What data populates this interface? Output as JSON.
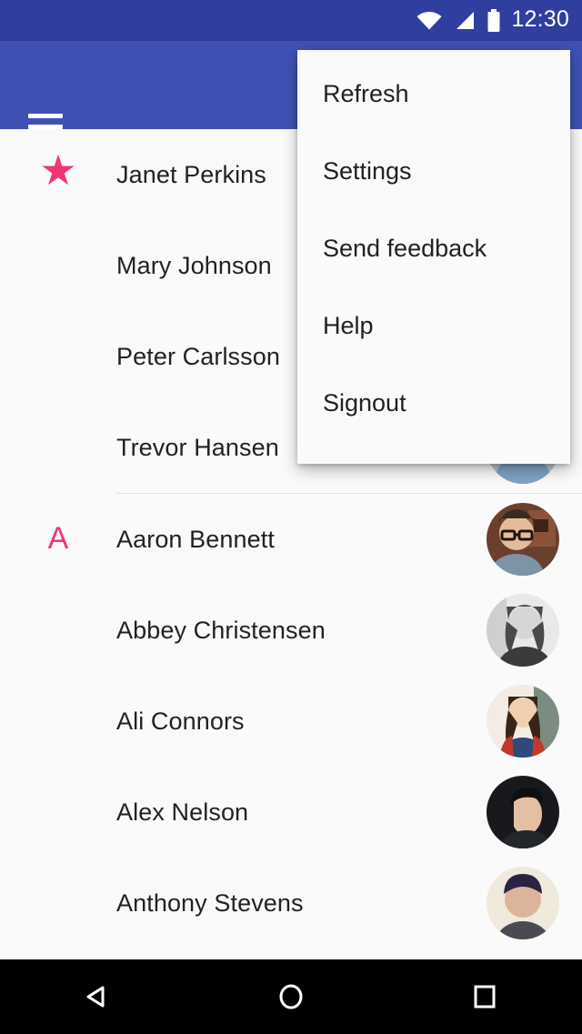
{
  "status_bar": {
    "clock": "12:30",
    "icons": [
      "wifi-icon",
      "cellular-signal-icon",
      "battery-icon"
    ],
    "background_color": "#303F9F"
  },
  "app_bar": {
    "background_color": "#3F51B5",
    "menu_icon": "hamburger-menu-icon",
    "title": ""
  },
  "overflow_menu": {
    "visible": true,
    "background_color": "#FAFAFA",
    "items": [
      {
        "label": "Refresh"
      },
      {
        "label": "Settings"
      },
      {
        "label": "Send feedback"
      },
      {
        "label": "Help"
      },
      {
        "label": "Signout"
      }
    ]
  },
  "contact_list": {
    "accent_color": "#F0356F",
    "background_color": "#FAFAFA",
    "sections": [
      {
        "header": "★",
        "header_type": "star-icon",
        "contacts": [
          {
            "name": "Janet Perkins",
            "avatar": "avatar-janet-perkins"
          },
          {
            "name": "Mary Johnson",
            "avatar": "avatar-mary-johnson"
          },
          {
            "name": "Peter Carlsson",
            "avatar": "avatar-peter-carlsson"
          },
          {
            "name": "Trevor Hansen",
            "avatar": "avatar-trevor-hansen"
          }
        ]
      },
      {
        "header": "A",
        "header_type": "letter",
        "contacts": [
          {
            "name": "Aaron Bennett",
            "avatar": "avatar-aaron-bennett"
          },
          {
            "name": "Abbey Christensen",
            "avatar": "avatar-abbey-christensen"
          },
          {
            "name": "Ali Connors",
            "avatar": "avatar-ali-connors"
          },
          {
            "name": "Alex Nelson",
            "avatar": "avatar-alex-nelson"
          },
          {
            "name": "Anthony Stevens",
            "avatar": "avatar-anthony-stevens"
          }
        ]
      }
    ]
  },
  "nav_bar": {
    "background_color": "#000000",
    "buttons": [
      {
        "name": "back-button",
        "icon": "triangle-left-icon"
      },
      {
        "name": "home-button",
        "icon": "circle-icon"
      },
      {
        "name": "recents-button",
        "icon": "square-icon"
      }
    ]
  }
}
